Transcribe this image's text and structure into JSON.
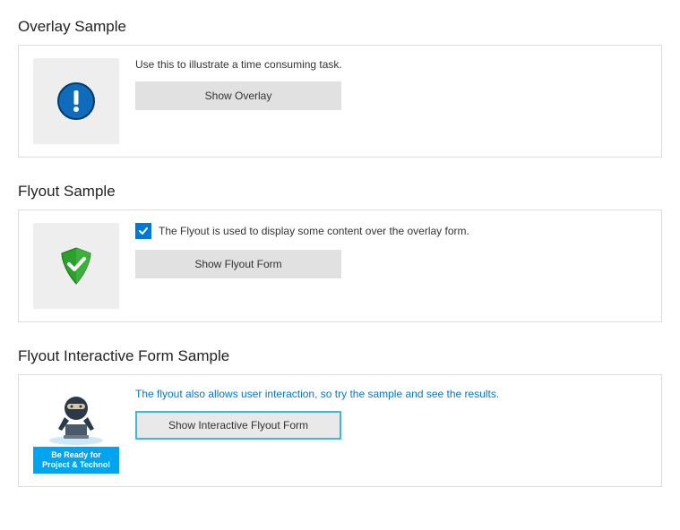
{
  "sections": {
    "overlay": {
      "title": "Overlay Sample",
      "description": "Use this to illustrate a time consuming task.",
      "button_label": "Show Overlay",
      "icon": "exclamation-circle"
    },
    "flyout": {
      "title": "Flyout Sample",
      "checkbox_checked": true,
      "checkbox_label": "The Flyout is used to display some content over the overlay form.",
      "button_label": "Show Flyout Form",
      "icon": "shield-check"
    },
    "flyout_interactive": {
      "title": "Flyout Interactive Form Sample",
      "description": "The flyout also allows user interaction, so try the sample and see the results.",
      "button_label": "Show Interactive Flyout Form",
      "promo_line1": "Be Ready for",
      "promo_line2": "Project & Technol"
    }
  }
}
